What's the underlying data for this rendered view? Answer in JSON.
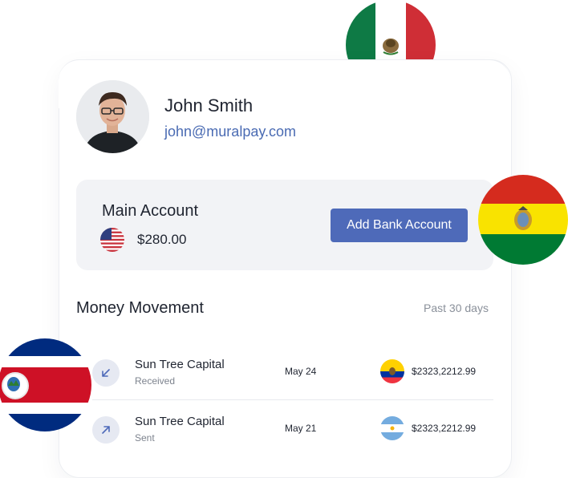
{
  "profile": {
    "name": "John Smith",
    "email": "john@muralpay.com"
  },
  "account": {
    "title": "Main Account",
    "balance": "$280.00",
    "add_button_label": "Add Bank Account"
  },
  "money_movement": {
    "title": "Money Movement",
    "period": "Past 30 days",
    "transactions": [
      {
        "counterparty": "Sun Tree Capital",
        "status": "Received",
        "date": "May 24",
        "amount": "$2323,2212.99",
        "flag": "ecuador-flag-icon",
        "direction": "arrow-down-left-icon"
      },
      {
        "counterparty": "Sun Tree Capital",
        "status": "Sent",
        "date": "May 21",
        "amount": "$2323,2212.99",
        "flag": "argentina-flag-icon",
        "direction": "arrow-up-right-icon"
      }
    ]
  },
  "colors": {
    "accent": "#4e6ab9",
    "email": "#4a6bb3",
    "panel": "#f2f3f6"
  }
}
